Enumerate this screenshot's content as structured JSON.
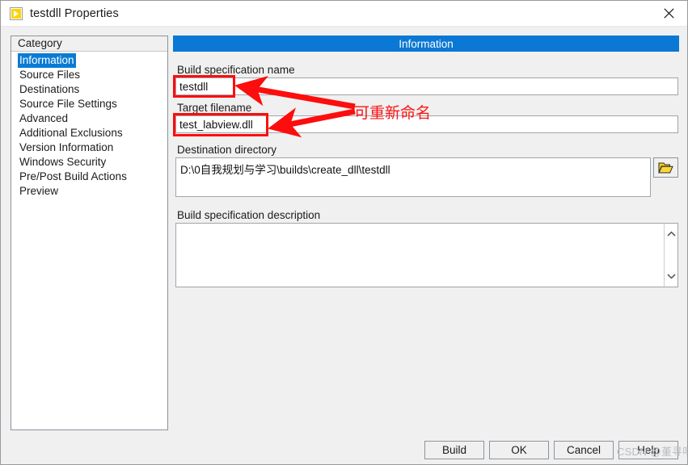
{
  "window": {
    "title": "testdll Properties",
    "icon": "labview-vi-icon",
    "close_icon": "close-icon"
  },
  "category": {
    "header": "Category",
    "items": [
      {
        "label": "Information",
        "selected": true
      },
      {
        "label": "Source Files",
        "selected": false
      },
      {
        "label": "Destinations",
        "selected": false
      },
      {
        "label": "Source File Settings",
        "selected": false
      },
      {
        "label": "Advanced",
        "selected": false
      },
      {
        "label": "Additional Exclusions",
        "selected": false
      },
      {
        "label": "Version Information",
        "selected": false
      },
      {
        "label": "Windows Security",
        "selected": false
      },
      {
        "label": "Pre/Post Build Actions",
        "selected": false
      },
      {
        "label": "Preview",
        "selected": false
      }
    ]
  },
  "panel": {
    "header": "Information",
    "build_spec_name": {
      "label": "Build specification name",
      "value": "testdll",
      "placeholder": ""
    },
    "target_filename": {
      "label": "Target filename",
      "value": "test_labview.dll",
      "placeholder": ""
    },
    "destination_directory": {
      "label": "Destination directory",
      "value": "D:\\0自我规划与学习\\builds\\create_dll\\testdll",
      "browse_icon": "folder-open-icon"
    },
    "build_spec_description": {
      "label": "Build specification description",
      "value": "",
      "placeholder": "",
      "scroll_up_icon": "chevron-up-icon",
      "scroll_down_icon": "chevron-down-icon"
    }
  },
  "buttons": {
    "build": "Build",
    "ok": "OK",
    "cancel": "Cancel",
    "help": "Help"
  },
  "watermark": "CSDN @堇寻哨",
  "annotation": {
    "text": "可重新命名",
    "color": "#fd1414"
  },
  "colors": {
    "accent_blue": "#0a78d4",
    "selection_blue": "#0a7bd4",
    "dialog_gray": "#f0f0f0",
    "annotation_red": "#fd0d0d",
    "icon_yellow": "#ffd400"
  }
}
